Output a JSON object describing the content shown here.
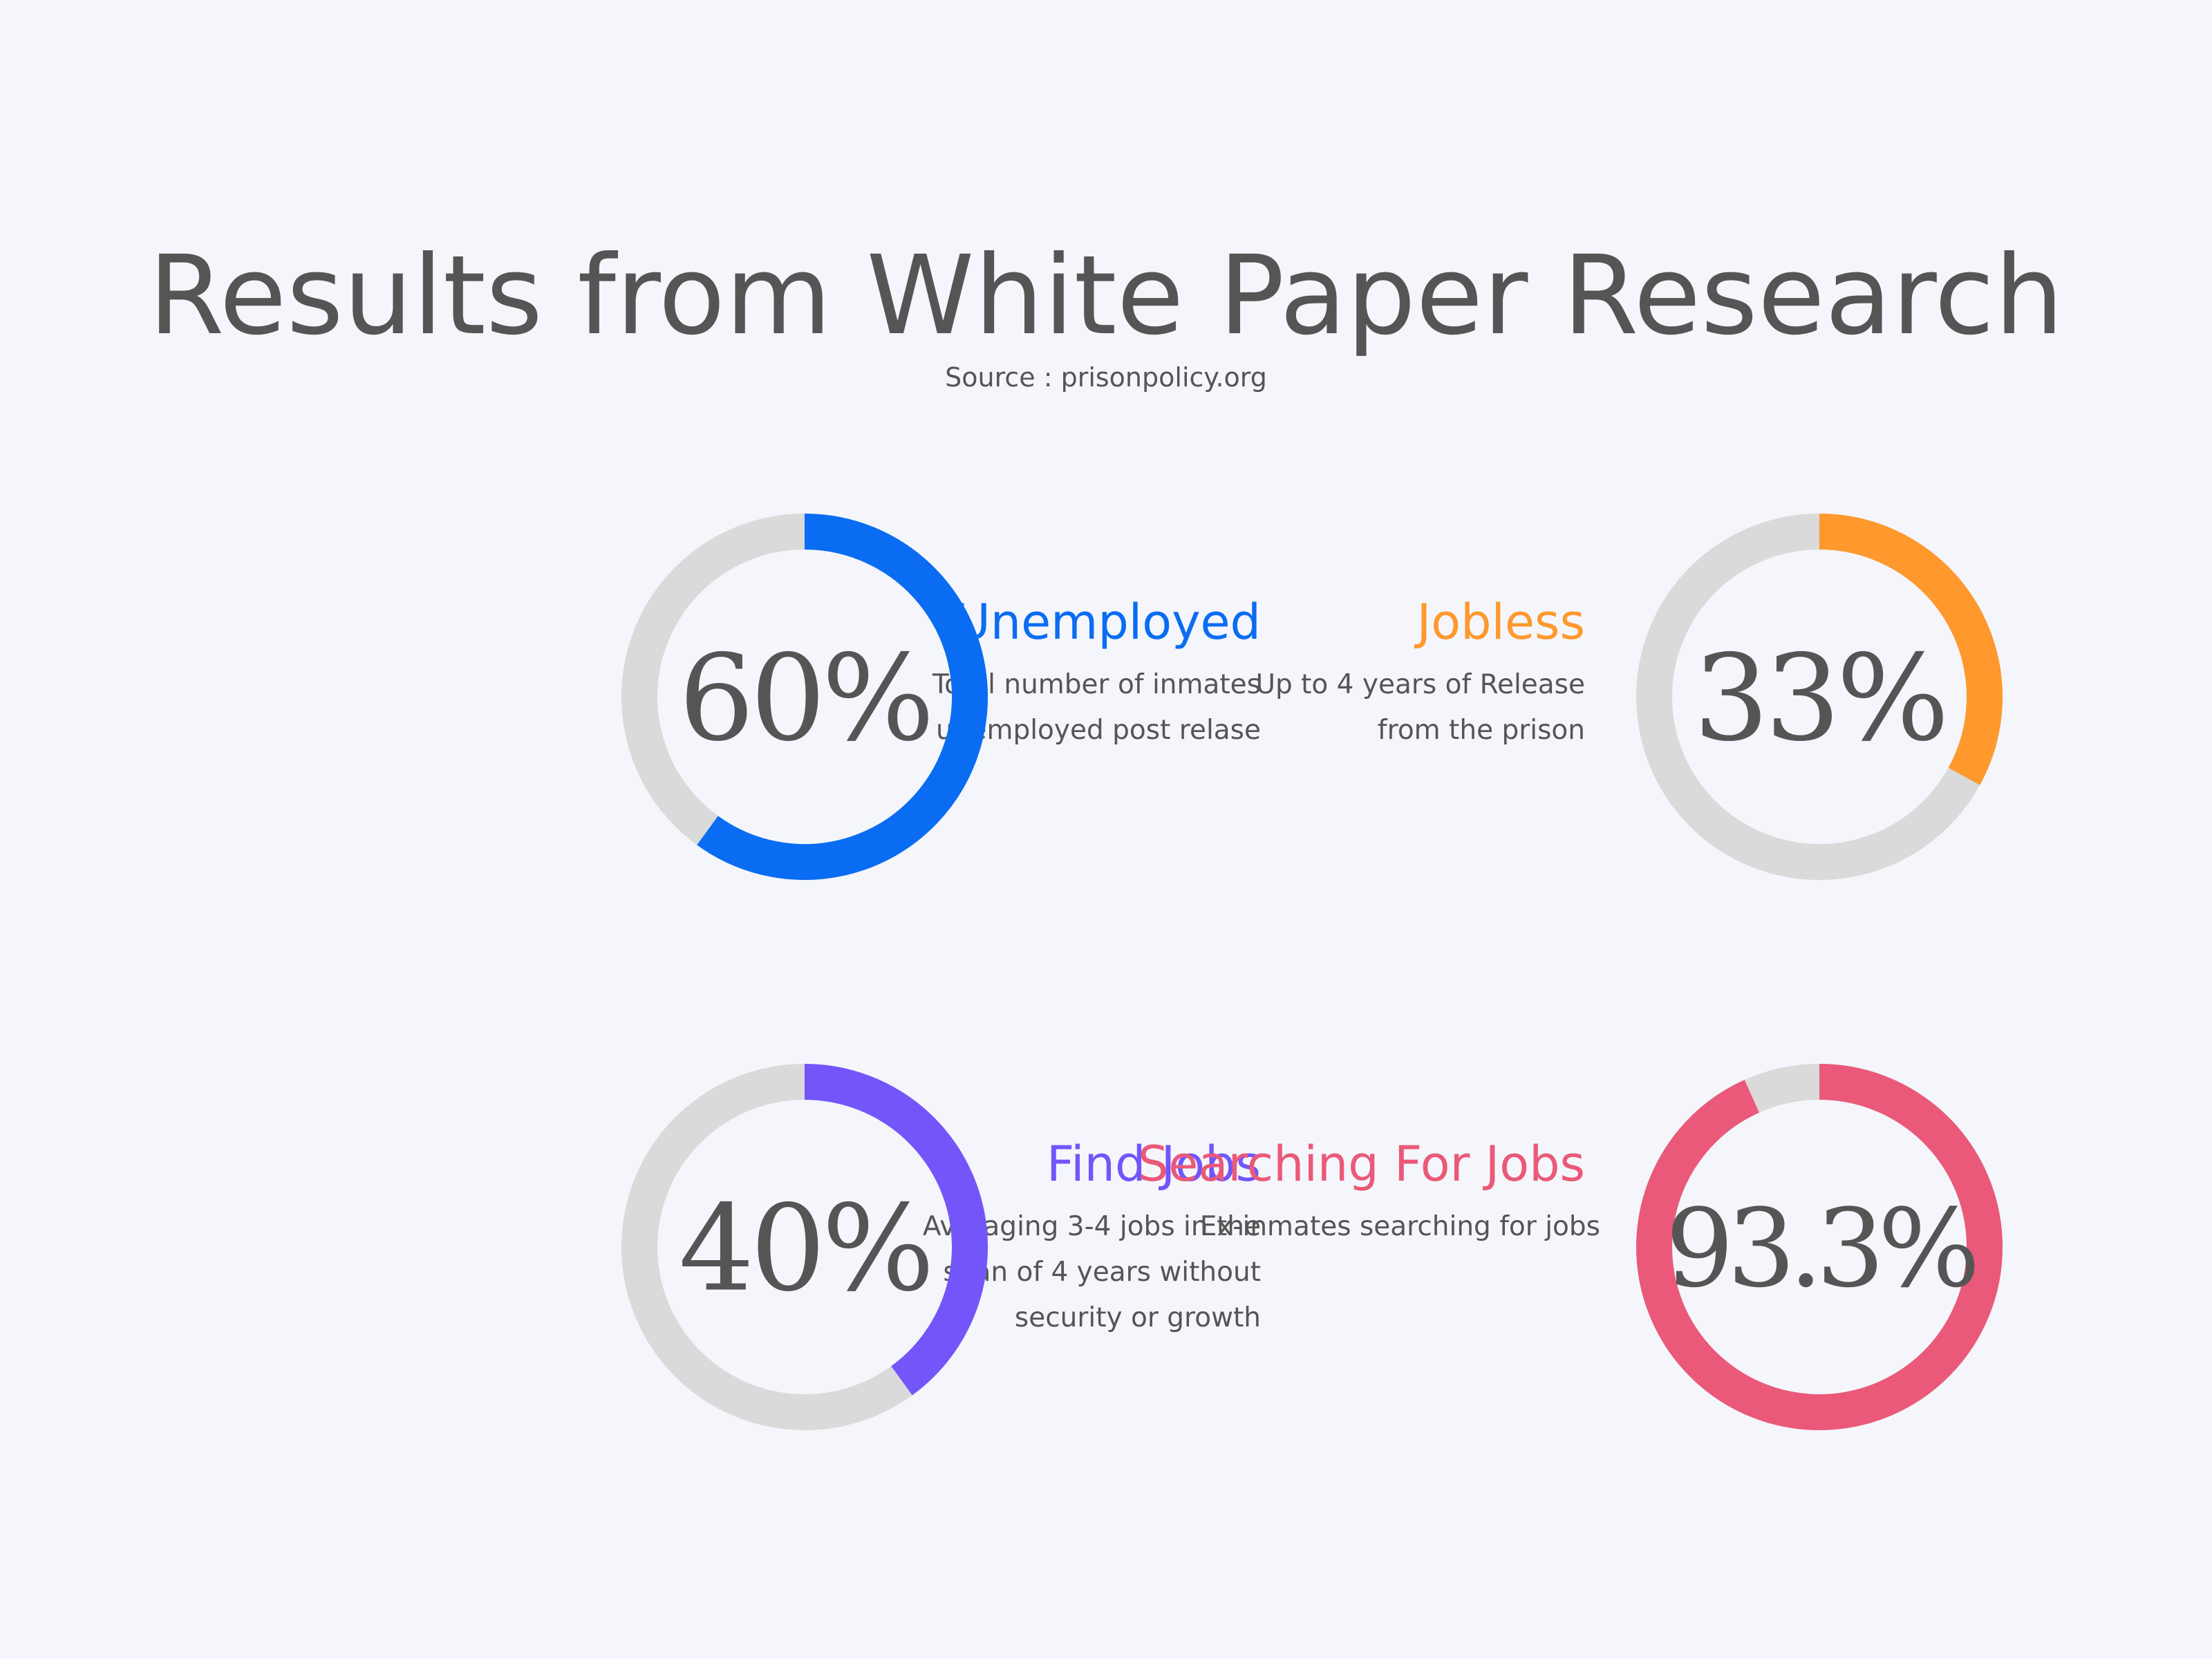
{
  "header": {
    "title": "Results from White Paper Research",
    "source": "Source : prisonpolicy.org"
  },
  "stats": [
    {
      "title": "Unemployed",
      "description_lines": [
        "Total number of inmates",
        "unemployed post relase"
      ],
      "value_text": "60%",
      "color": "#0a6cf2"
    },
    {
      "title": "Jobless",
      "description_lines": [
        "Up to 4 years of Release",
        "from the prison"
      ],
      "value_text": "33%",
      "color": "#ff982d"
    },
    {
      "title": "Find Jobs",
      "description_lines": [
        "Averaging 3-4 jobs in the",
        "span of 4 years without",
        "security or growth"
      ],
      "value_text": "40%",
      "color": "#7355fa"
    },
    {
      "title": "Searching For Jobs",
      "description_lines": [
        "Ex-inmates searching for jobs"
      ],
      "value_text": "93.3%",
      "color": "#ea5979"
    }
  ],
  "chart_data": [
    {
      "type": "pie",
      "series": [
        {
          "name": "Unemployed",
          "value": 60
        }
      ],
      "max": 100,
      "track_color": "#dadada"
    },
    {
      "type": "pie",
      "series": [
        {
          "name": "Jobless",
          "value": 33
        }
      ],
      "max": 100,
      "track_color": "#dadada"
    },
    {
      "type": "pie",
      "series": [
        {
          "name": "Find Jobs",
          "value": 40
        }
      ],
      "max": 100,
      "track_color": "#dadada"
    },
    {
      "type": "pie",
      "series": [
        {
          "name": "Searching For Jobs",
          "value": 93.3
        }
      ],
      "max": 100,
      "track_color": "#dadada"
    }
  ]
}
